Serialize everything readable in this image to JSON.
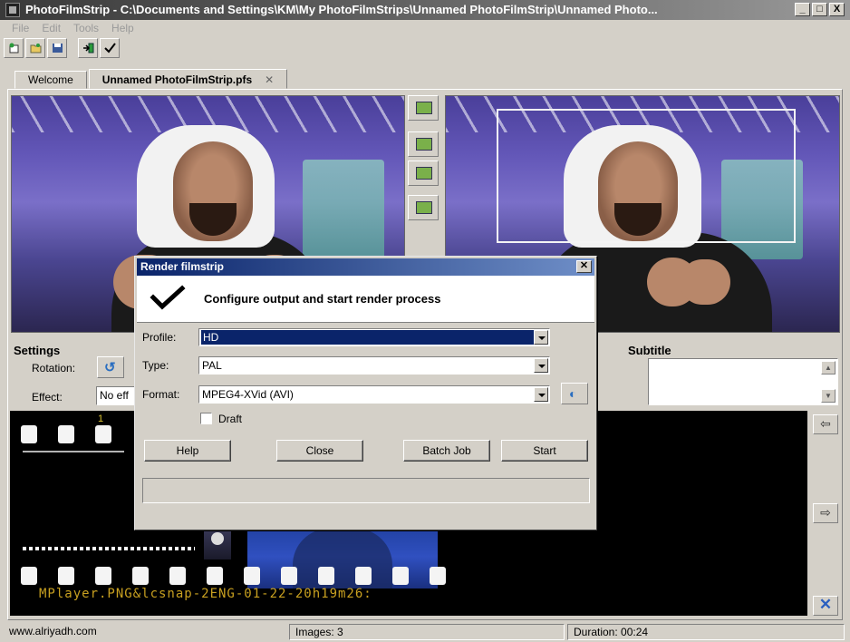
{
  "window": {
    "title": "PhotoFilmStrip - C:\\Documents and Settings\\KM\\My PhotoFilmStrips\\Unnamed PhotoFilmStrip\\Unnamed Photo...",
    "min": "_",
    "max": "□",
    "close": "X"
  },
  "menu": [
    "File",
    "Edit",
    "Tools",
    "Help"
  ],
  "tabs": [
    {
      "label": "Welcome"
    },
    {
      "label": "Unnamed PhotoFilmStrip.pfs",
      "close": "✕"
    }
  ],
  "settings": {
    "heading": "Settings",
    "rotation_label": "Rotation:",
    "effect_label": "Effect:",
    "effect_value": "No eff"
  },
  "subtitle": {
    "heading": "Subtitle",
    "up": "▲",
    "down": "▼"
  },
  "filmstrip": {
    "frame_number": "1",
    "overlay_text": "MPlayer.PNG&lcsnap-2ENG-01-22-20h19m26:"
  },
  "side_buttons": {
    "left_arrow": "⇦",
    "right_arrow": "⇨",
    "remove": "✕"
  },
  "status": {
    "watermark": "www.alriyadh.com",
    "images": "Images: 3",
    "duration": "Duration: 00:24"
  },
  "dialog": {
    "title": "Render filmstrip",
    "close": "✕",
    "header": "Configure output and start render process",
    "profile_label": "Profile:",
    "profile_value": "HD",
    "type_label": "Type:",
    "type_value": "PAL",
    "format_label": "Format:",
    "format_value": "MPEG4-XVid (AVI)",
    "draft_label": "Draft",
    "buttons": {
      "help": "Help",
      "close": "Close",
      "batch": "Batch Job",
      "start": "Start"
    }
  },
  "colors": {
    "face": "#d4d0c8",
    "dialog_title": "#0a246a",
    "film": "#000000",
    "film_text": "#c8a020"
  }
}
